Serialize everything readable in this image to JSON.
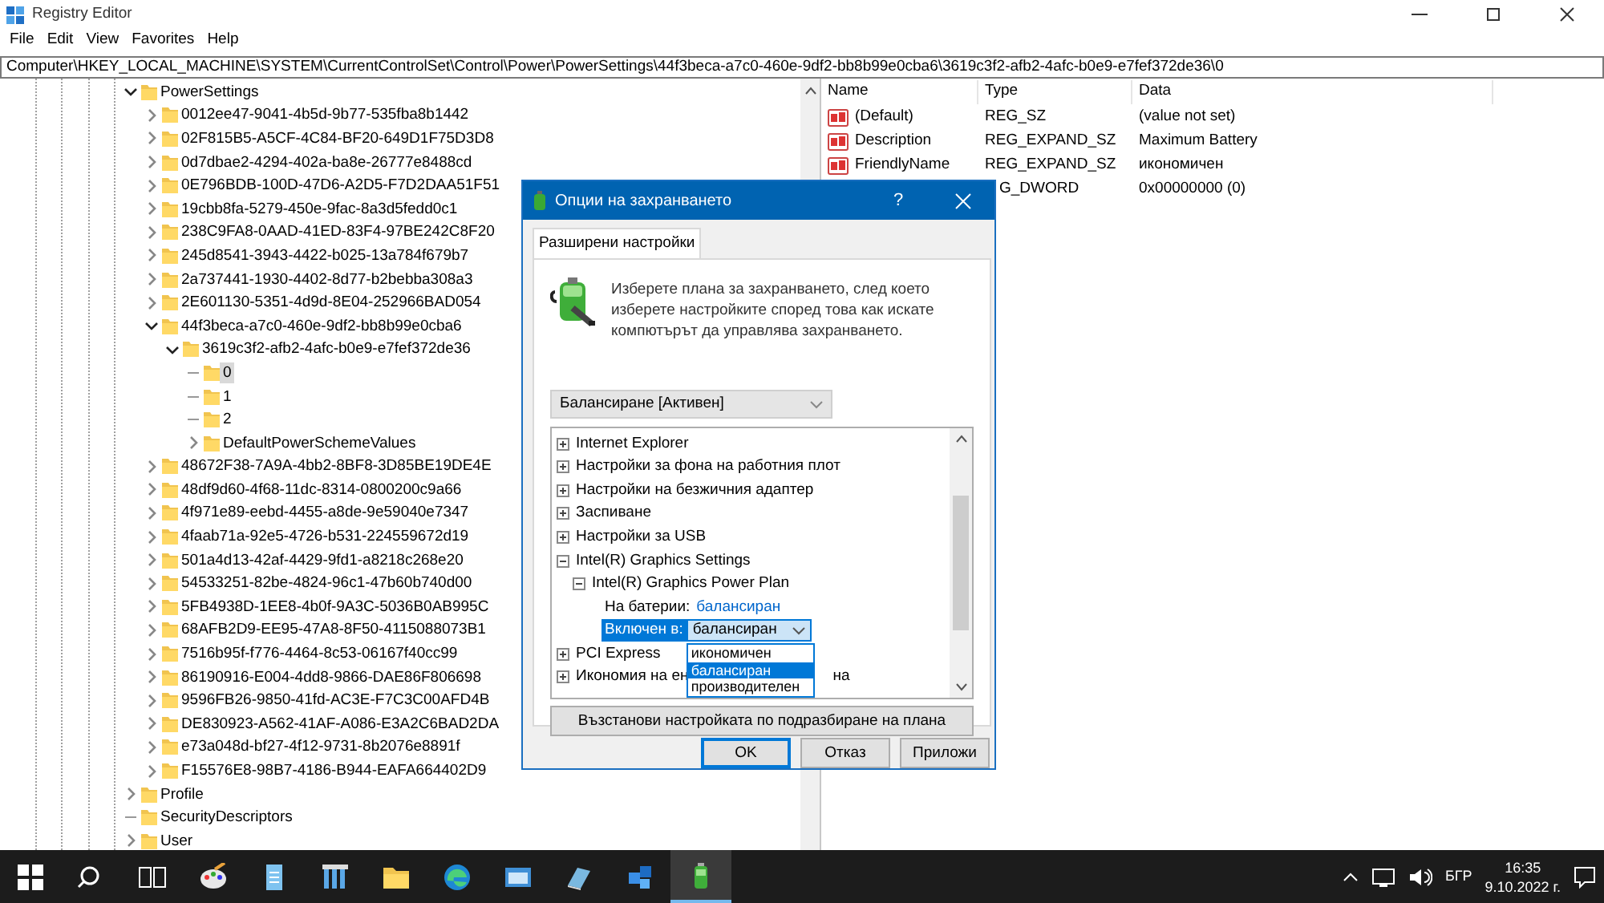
{
  "window": {
    "title": "Registry Editor"
  },
  "menu": [
    "File",
    "Edit",
    "View",
    "Favorites",
    "Help"
  ],
  "address": "Computer\\HKEY_LOCAL_MACHINE\\SYSTEM\\CurrentControlSet\\Control\\Power\\PowerSettings\\44f3beca-a7c0-460e-9df2-bb8b99e0cba6\\3619c3f2-afb2-4afc-b0e9-e7fef372de36\\0",
  "tree": [
    {
      "label": "PowerSettings",
      "expandable": true,
      "expanded": true,
      "selected": false,
      "children": [
        {
          "label": "0012ee47-9041-4b5d-9b77-535fba8b1442",
          "expandable": true,
          "expanded": false,
          "selected": false
        },
        {
          "label": "02F815B5-A5CF-4C84-BF20-649D1F75D3D8",
          "expandable": true,
          "expanded": false,
          "selected": false
        },
        {
          "label": "0d7dbae2-4294-402a-ba8e-26777e8488cd",
          "expandable": true,
          "expanded": false,
          "selected": false
        },
        {
          "label": "0E796BDB-100D-47D6-A2D5-F7D2DAA51F51",
          "expandable": true,
          "expanded": false,
          "selected": false
        },
        {
          "label": "19cbb8fa-5279-450e-9fac-8a3d5fedd0c1",
          "expandable": true,
          "expanded": false,
          "selected": false
        },
        {
          "label": "238C9FA8-0AAD-41ED-83F4-97BE242C8F20",
          "expandable": true,
          "expanded": false,
          "selected": false
        },
        {
          "label": "245d8541-3943-4422-b025-13a784f679b7",
          "expandable": true,
          "expanded": false,
          "selected": false
        },
        {
          "label": "2a737441-1930-4402-8d77-b2bebba308a3",
          "expandable": true,
          "expanded": false,
          "selected": false
        },
        {
          "label": "2E601130-5351-4d9d-8E04-252966BAD054",
          "expandable": true,
          "expanded": false,
          "selected": false
        },
        {
          "label": "44f3beca-a7c0-460e-9df2-bb8b99e0cba6",
          "expandable": true,
          "expanded": true,
          "selected": false,
          "children": [
            {
              "label": "3619c3f2-afb2-4afc-b0e9-e7fef372de36",
              "expandable": true,
              "expanded": true,
              "selected": false,
              "children": [
                {
                  "label": "0",
                  "selected": true
                },
                {
                  "label": "1",
                  "selected": false
                },
                {
                  "label": "2",
                  "selected": false
                },
                {
                  "label": "DefaultPowerSchemeValues",
                  "expandable": true,
                  "expanded": false,
                  "selected": false
                }
              ]
            }
          ]
        },
        {
          "label": "48672F38-7A9A-4bb2-8BF8-3D85BE19DE4E",
          "expandable": true,
          "expanded": false,
          "selected": false
        },
        {
          "label": "48df9d60-4f68-11dc-8314-0800200c9a66",
          "expandable": true,
          "expanded": false,
          "selected": false
        },
        {
          "label": "4f971e89-eebd-4455-a8de-9e59040e7347",
          "expandable": true,
          "expanded": false,
          "selected": false
        },
        {
          "label": "4faab71a-92e5-4726-b531-224559672d19",
          "expandable": true,
          "expanded": false,
          "selected": false
        },
        {
          "label": "501a4d13-42af-4429-9fd1-a8218c268e20",
          "expandable": true,
          "expanded": false,
          "selected": false
        },
        {
          "label": "54533251-82be-4824-96c1-47b60b740d00",
          "expandable": true,
          "expanded": false,
          "selected": false
        },
        {
          "label": "5FB4938D-1EE8-4b0f-9A3C-5036B0AB995C",
          "expandable": true,
          "expanded": false,
          "selected": false
        },
        {
          "label": "68AFB2D9-EE95-47A8-8F50-4115088073B1",
          "expandable": true,
          "expanded": false,
          "selected": false
        },
        {
          "label": "7516b95f-f776-4464-8c53-06167f40cc99",
          "expandable": true,
          "expanded": false,
          "selected": false
        },
        {
          "label": "86190916-E004-4dd8-9866-DAE86F806698",
          "expandable": true,
          "expanded": false,
          "selected": false
        },
        {
          "label": "9596FB26-9850-41fd-AC3E-F7C3C00AFD4B",
          "expandable": true,
          "expanded": false,
          "selected": false
        },
        {
          "label": "DE830923-A562-41AF-A086-E3A2C6BAD2DA",
          "expandable": true,
          "expanded": false,
          "selected": false
        },
        {
          "label": "e73a048d-bf27-4f12-9731-8b2076e8891f",
          "expandable": true,
          "expanded": false,
          "selected": false
        },
        {
          "label": "F15576E8-98B7-4186-B944-EAFA664402D9",
          "expandable": true,
          "expanded": false,
          "selected": false
        }
      ]
    },
    {
      "label": "Profile",
      "expandable": true,
      "expanded": false,
      "selected": false
    },
    {
      "label": "SecurityDescriptors",
      "selected": false
    },
    {
      "label": "User",
      "expandable": true,
      "expanded": false,
      "selected": false
    }
  ],
  "values": {
    "columns": [
      "Name",
      "Type",
      "Data"
    ],
    "rows": [
      {
        "name": "(Default)",
        "type": "REG_SZ",
        "data": "(value not set)"
      },
      {
        "name": "Description",
        "type": "REG_EXPAND_SZ",
        "data": "Maximum Battery"
      },
      {
        "name": "FriendlyName",
        "type": "REG_EXPAND_SZ",
        "data": "икономичен"
      },
      {
        "type": "G_DWORD",
        "data": "0x00000000 (0)"
      }
    ]
  },
  "dialog": {
    "title": "Опции на захранването",
    "help": "?",
    "tabs": [
      {
        "label": "Разширени настройки",
        "selected": true
      }
    ],
    "description": "Изберете плана за захранването, след което изберете настройките според това как искате компютърът да управлява захранването.",
    "plan": "Балансиране [Активен]",
    "settings": [
      {
        "kind": "group",
        "label": "Internet Explorer",
        "expanded": false,
        "selected": false
      },
      {
        "kind": "group",
        "label": "Настройки за фона на работния плот",
        "expanded": false,
        "selected": false
      },
      {
        "kind": "group",
        "label": "Настройки на безжичния адаптер",
        "expanded": false,
        "selected": false
      },
      {
        "kind": "group",
        "label": "Заспиване",
        "expanded": false,
        "selected": false
      },
      {
        "kind": "group",
        "label": "Настройки за USB",
        "expanded": false,
        "selected": false
      },
      {
        "kind": "group",
        "label": "Intel(R) Graphics Settings",
        "expanded": true,
        "selected": false,
        "children": [
          {
            "kind": "group",
            "label": "Intel(R) Graphics Power Plan",
            "expanded": true,
            "selected": false,
            "children": [
              {
                "kind": "value",
                "label": "На батерии:",
                "value": "балансиран",
                "selected": false
              },
              {
                "kind": "choice",
                "label": "Включен в:",
                "value": "балансиран",
                "selected": true,
                "open": true,
                "options": [
                  {
                    "label": "икономичен",
                    "selected": false
                  },
                  {
                    "label": "балансиран",
                    "selected": true
                  },
                  {
                    "label": "производителен",
                    "selected": false
                  }
                ]
              }
            ]
          }
        ]
      },
      {
        "kind": "group",
        "label": "PCI Express",
        "expanded": false,
        "selected": false
      },
      {
        "kind": "group",
        "label": "Икономия на ен",
        "label_tail": "на",
        "expanded": false,
        "selected": false
      }
    ],
    "restore": "Възстанови настройката по подразбиране на плана",
    "buttons": [
      {
        "label": "OK",
        "default": true
      },
      {
        "label": "Отказ",
        "default": false
      },
      {
        "label": "Приложи",
        "default": false
      }
    ]
  },
  "taskbar": {
    "apps": [
      {
        "kind": "paint",
        "active": false
      },
      {
        "kind": "notepad",
        "active": false
      },
      {
        "kind": "calculator",
        "active": false
      },
      {
        "kind": "folder",
        "active": false
      },
      {
        "kind": "edge",
        "active": false
      },
      {
        "kind": "window",
        "active": false
      },
      {
        "kind": "book",
        "active": false
      },
      {
        "kind": "puzzle",
        "active": false
      },
      {
        "kind": "battery",
        "active": true
      }
    ],
    "language": "БГР",
    "time": "16:35",
    "date": "9.10.2022 г."
  }
}
